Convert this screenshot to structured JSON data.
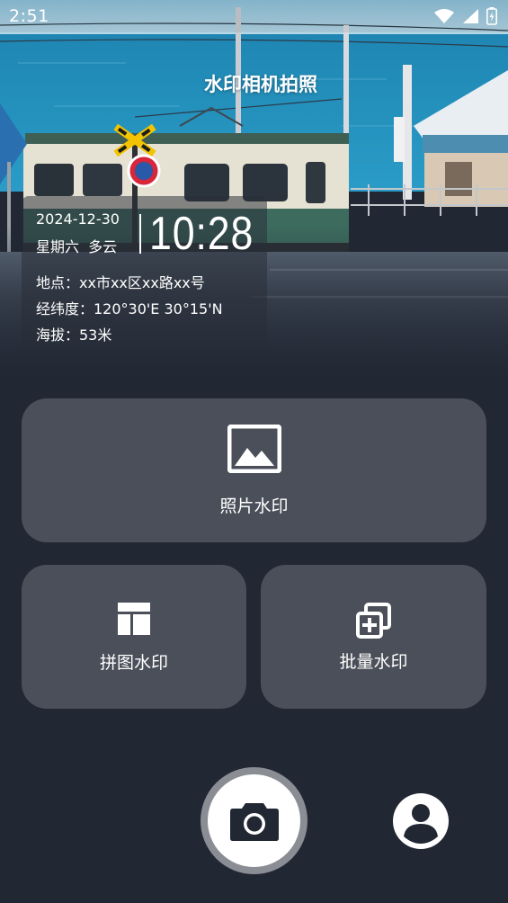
{
  "status_bar": {
    "time": "2:51",
    "icons": [
      "wifi-icon",
      "signal-icon",
      "battery-charging-icon"
    ]
  },
  "app": {
    "title": "水印相机拍照"
  },
  "watermark": {
    "date": "2024-12-30",
    "weekday_weather": "星期六  多云",
    "clock": "10:28",
    "location": "地点：xx市xx区xx路xx号",
    "coordinates": "经纬度：120°30'E 30°15'N",
    "altitude": "海拔：53米"
  },
  "actions": {
    "photo_watermark": {
      "label": "照片水印",
      "icon": "image-icon"
    },
    "collage_watermark": {
      "label": "拼图水印",
      "icon": "collage-layout-icon"
    },
    "batch_watermark": {
      "label": "批量水印",
      "icon": "batch-add-icon"
    }
  },
  "bottom_bar": {
    "shutter_icon": "camera-icon",
    "profile_icon": "user-profile-icon"
  },
  "colors": {
    "background": "#212733",
    "card": "#4b4f59",
    "shutter_ring": "#8a8d93",
    "text": "#ffffff"
  }
}
